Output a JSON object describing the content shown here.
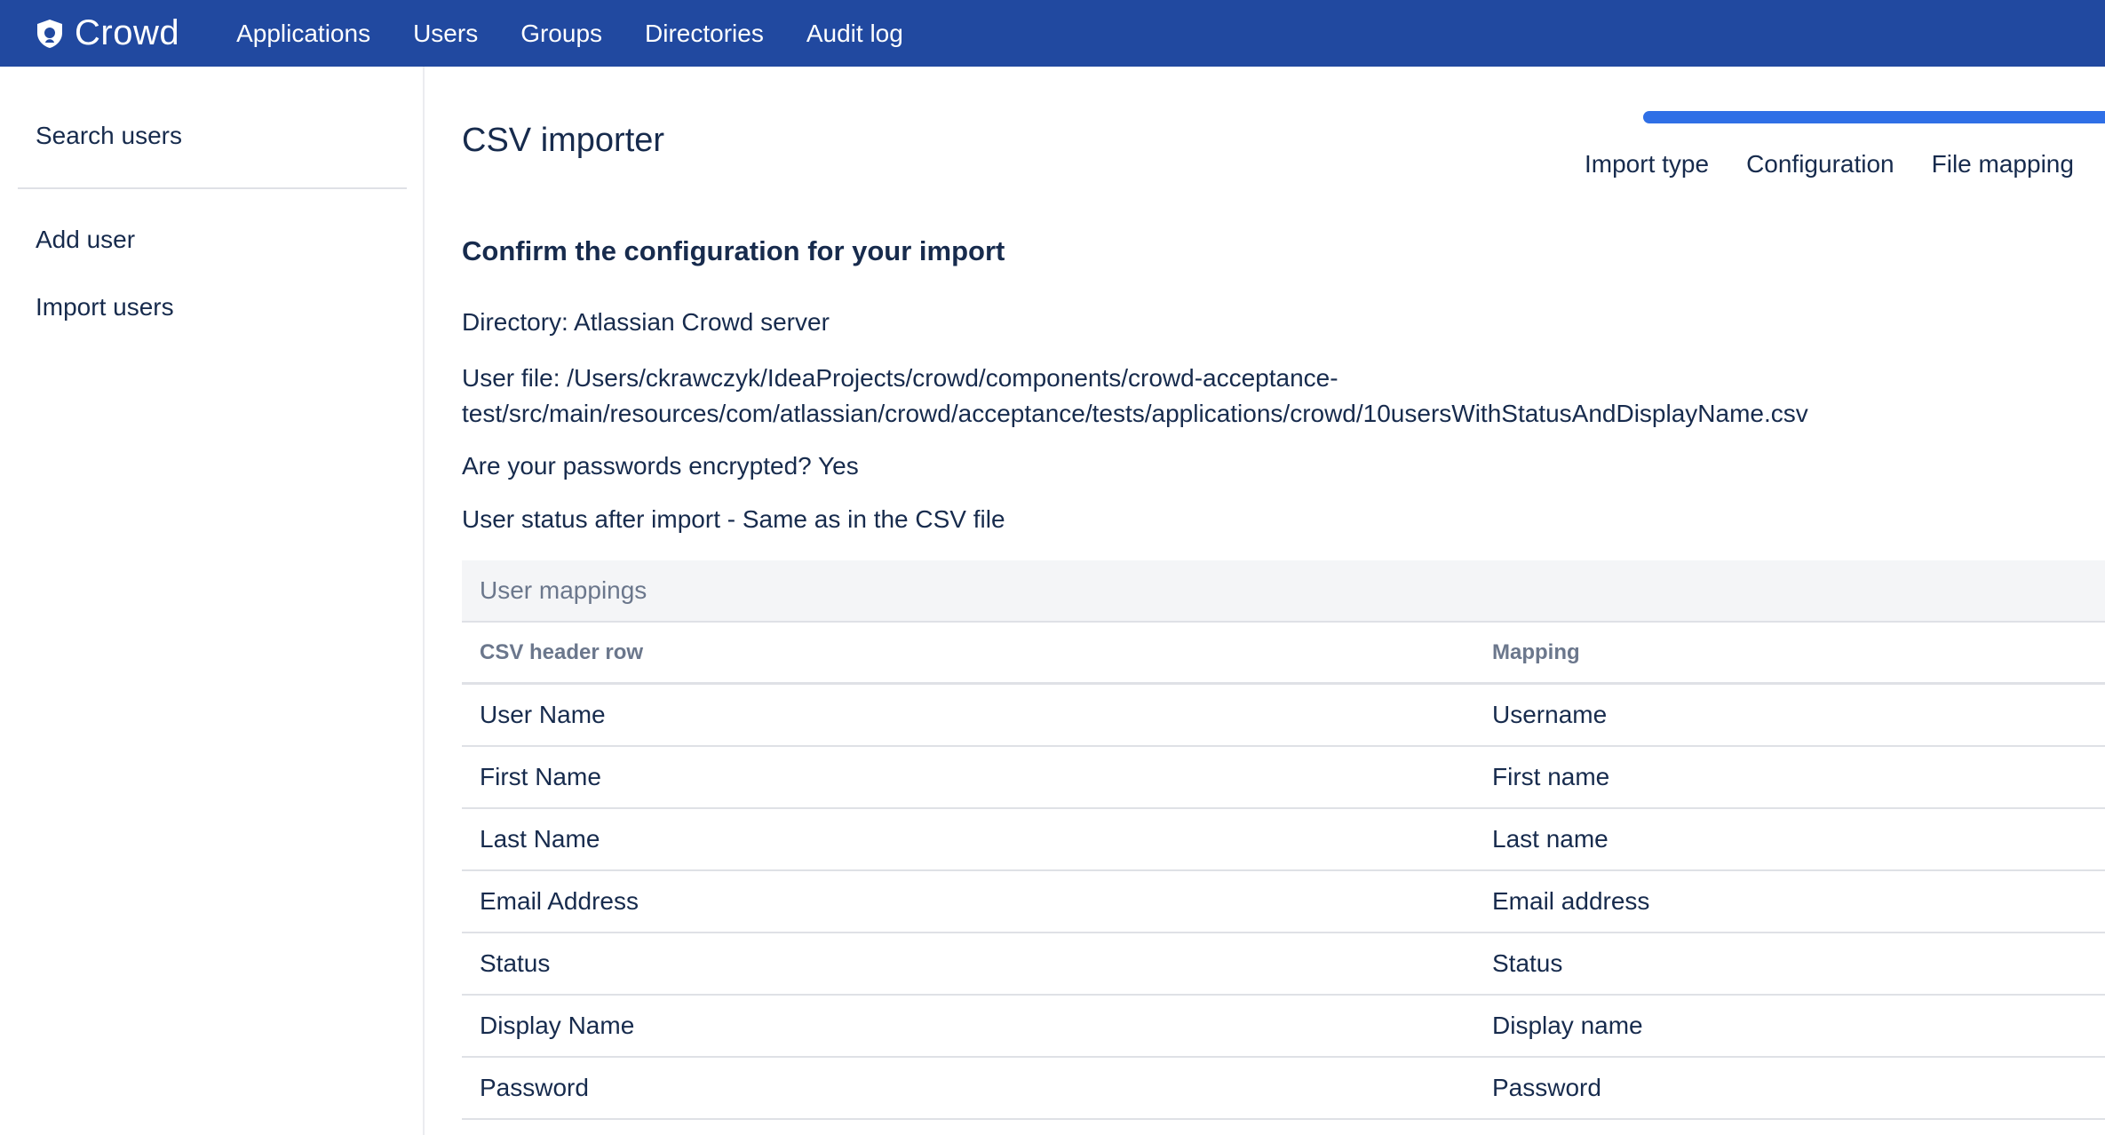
{
  "header": {
    "app_name": "Crowd",
    "nav": [
      "Applications",
      "Users",
      "Groups",
      "Directories",
      "Audit log"
    ]
  },
  "sidebar": {
    "items": [
      {
        "label": "Search users"
      },
      {
        "label": "Add user"
      },
      {
        "label": "Import users"
      }
    ]
  },
  "main": {
    "title": "CSV importer",
    "steps": [
      "Import type",
      "Configuration",
      "File mapping"
    ],
    "section_heading": "Confirm the configuration for your import",
    "directory_line": "Directory: Atlassian Crowd server",
    "user_file_line_1": "User file: /Users/ckrawczyk/IdeaProjects/crowd/components/crowd-acceptance-",
    "user_file_line_2": "test/src/main/resources/com/atlassian/crowd/acceptance/tests/applications/crowd/10usersWithStatusAndDisplayName.csv",
    "passwords_line": "Are your passwords encrypted? Yes",
    "status_line": "User status after import - Same as in the CSV file",
    "table": {
      "caption": "User mappings",
      "headers": [
        "CSV header row",
        "Mapping"
      ],
      "rows": [
        [
          "User Name",
          "Username"
        ],
        [
          "First Name",
          "First name"
        ],
        [
          "Last Name",
          "Last name"
        ],
        [
          "Email Address",
          "Email address"
        ],
        [
          "Status",
          "Status"
        ],
        [
          "Display Name",
          "Display name"
        ],
        [
          "Password",
          "Password"
        ]
      ]
    }
  },
  "colors": {
    "header_bg": "#2149a0",
    "progress": "#2f6fe6",
    "text": "#172b4d",
    "muted": "#6b778c"
  }
}
